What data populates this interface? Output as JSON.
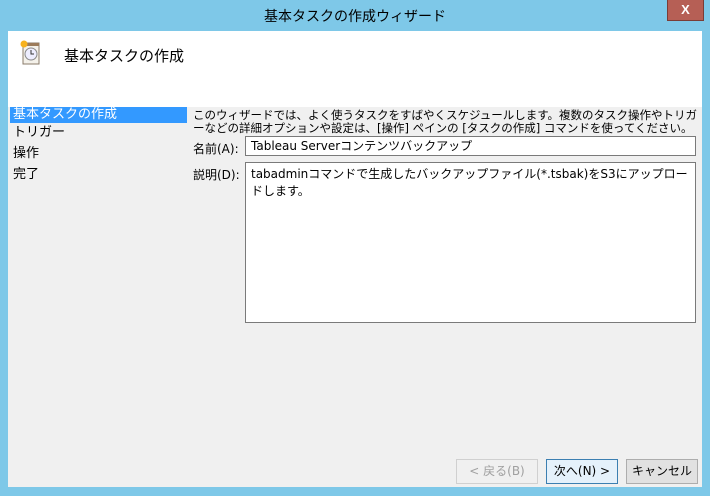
{
  "window": {
    "title": "基本タスクの作成ウィザード",
    "close_label": "X"
  },
  "header": {
    "title": "基本タスクの作成"
  },
  "nav": {
    "items": [
      "基本タスクの作成",
      "トリガー",
      "操作",
      "完了"
    ]
  },
  "main": {
    "description": "このウィザードでは、よく使うタスクをすばやくスケジュールします。複数のタスク操作やトリガーなどの詳細オプションや設定は、[操作] ペインの [タスクの作成] コマンドを使ってください。",
    "name_label": "名前(A):",
    "name_value": "Tableau Serverコンテンツバックアップ",
    "desc_label": "説明(D):",
    "desc_value": "tabadminコマンドで生成したバックアップファイル(*.tsbak)をS3にアップロードします。"
  },
  "buttons": {
    "back": "< 戻る(B)",
    "next": "次へ(N) >",
    "cancel": "キャンセル"
  }
}
